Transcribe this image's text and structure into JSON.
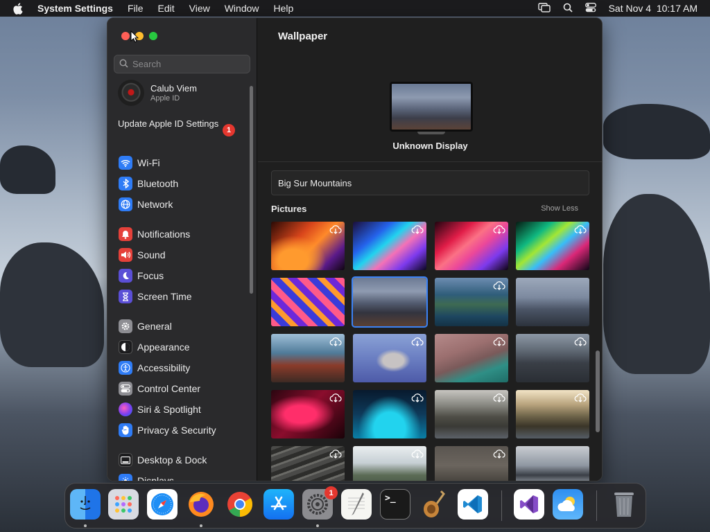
{
  "menubar": {
    "app_name": "System Settings",
    "menus": [
      "File",
      "Edit",
      "View",
      "Window",
      "Help"
    ],
    "datetime": "Sat Nov 4  10:17 AM"
  },
  "window": {
    "search": {
      "placeholder": "Search"
    },
    "account": {
      "name": "Calub Viem",
      "subtitle": "Apple ID"
    },
    "update": {
      "label": "Update Apple ID Settings",
      "badge": "1"
    },
    "sidebar": {
      "items": [
        {
          "label": "Wi-Fi",
          "icon": "wifi-icon",
          "color": "#2f7cf6"
        },
        {
          "label": "Bluetooth",
          "icon": "bluetooth-icon",
          "color": "#2f7cf6"
        },
        {
          "label": "Network",
          "icon": "globe-icon",
          "color": "#2f7cf6"
        },
        {
          "label": "Notifications",
          "icon": "bell-icon",
          "color": "#e5413a"
        },
        {
          "label": "Sound",
          "icon": "speaker-icon",
          "color": "#e5413a"
        },
        {
          "label": "Focus",
          "icon": "moon-icon",
          "color": "#5b4fd6"
        },
        {
          "label": "Screen Time",
          "icon": "hourglass-icon",
          "color": "#5b4fd6"
        },
        {
          "label": "General",
          "icon": "gear-icon",
          "color": "#8e8e93"
        },
        {
          "label": "Appearance",
          "icon": "appearance-icon",
          "color": "#1c1c1e"
        },
        {
          "label": "Accessibility",
          "icon": "accessibility-icon",
          "color": "#2f7cf6"
        },
        {
          "label": "Control Center",
          "icon": "control-center-icon",
          "color": "#8e8e93"
        },
        {
          "label": "Siri & Spotlight",
          "icon": "siri-icon",
          "color": "#b03fd9"
        },
        {
          "label": "Privacy & Security",
          "icon": "hand-icon",
          "color": "#2f7cf6"
        },
        {
          "label": "Desktop & Dock",
          "icon": "dock-icon",
          "color": "#1c1c1e"
        },
        {
          "label": "Displays",
          "icon": "display-icon",
          "color": "#2f7cf6"
        }
      ]
    },
    "content": {
      "title": "Wallpaper",
      "display_name": "Unknown Display",
      "current_wallpaper": "Big Sur Mountains",
      "pictures_label": "Pictures",
      "show_less": "Show Less",
      "thumbnails": [
        {
          "name": "macbook-pro-orange",
          "cloud": true,
          "selected": false
        },
        {
          "name": "macbook-pro-blue",
          "cloud": true,
          "selected": false
        },
        {
          "name": "macbook-pro-pink",
          "cloud": true,
          "selected": false
        },
        {
          "name": "macbook-pro-green",
          "cloud": true,
          "selected": false
        },
        {
          "name": "big-sur-graphic",
          "cloud": false,
          "selected": false
        },
        {
          "name": "big-sur-mountains",
          "cloud": false,
          "selected": true
        },
        {
          "name": "big-sur-coast",
          "cloud": true,
          "selected": false
        },
        {
          "name": "big-sur-rocks",
          "cloud": false,
          "selected": false
        },
        {
          "name": "big-sur-shore",
          "cloud": true,
          "selected": false
        },
        {
          "name": "big-sur-island",
          "cloud": true,
          "selected": false
        },
        {
          "name": "big-sur-cliff",
          "cloud": true,
          "selected": false
        },
        {
          "name": "big-sur-road",
          "cloud": true,
          "selected": false
        },
        {
          "name": "red-plant",
          "cloud": true,
          "selected": false
        },
        {
          "name": "blue-coral",
          "cloud": true,
          "selected": false
        },
        {
          "name": "catalina-hills",
          "cloud": true,
          "selected": false
        },
        {
          "name": "catalina-sunset",
          "cloud": true,
          "selected": false
        },
        {
          "name": "layered-rocks",
          "cloud": true,
          "selected": false
        },
        {
          "name": "coastline",
          "cloud": true,
          "selected": false
        },
        {
          "name": "cloudy-sea",
          "cloud": true,
          "selected": false
        },
        {
          "name": "catalina-island",
          "cloud": false,
          "selected": false
        }
      ]
    }
  },
  "dock": {
    "apps": [
      "Finder",
      "Launchpad",
      "Safari",
      "Firefox",
      "Chrome",
      "App Store",
      "System Settings",
      "TextEdit",
      "Terminal",
      "Instruments",
      "Visual Studio Code",
      "Visual Studio",
      "Weather",
      "Trash"
    ],
    "settings_badge": "1"
  }
}
